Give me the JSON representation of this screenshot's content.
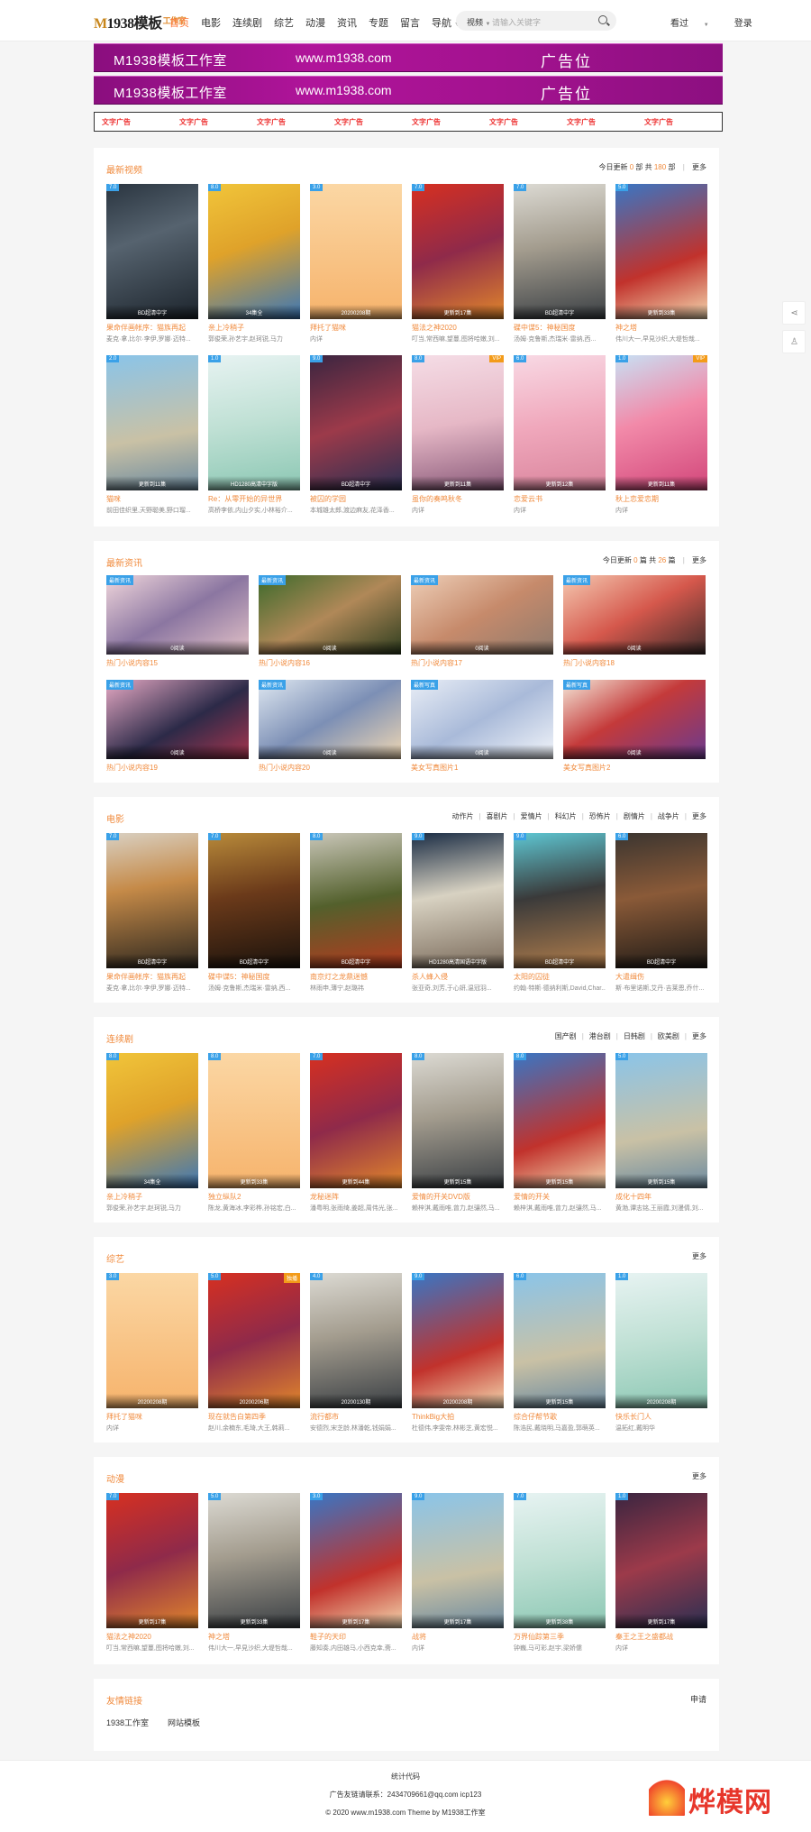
{
  "header": {
    "logo": {
      "m": "M",
      "num": "1938",
      "text": "模板",
      "sub": "工作室"
    },
    "nav": [
      "首页",
      "电影",
      "连续剧",
      "综艺",
      "动漫",
      "资讯",
      "专题",
      "留言",
      "导航"
    ],
    "search_select": "视频",
    "search_placeholder": "请输入关键字",
    "history": "看过",
    "login": "登录"
  },
  "banners": [
    {
      "t1": "M1938模板工作室",
      "t2": "www.m1938.com",
      "t3": "广告位"
    },
    {
      "t1": "M1938模板工作室",
      "t2": "www.m1938.com",
      "t3": "广告位"
    }
  ],
  "text_ads": [
    "文字广告",
    "文字广告",
    "文字广告",
    "文字广告",
    "文字广告",
    "文字广告",
    "文字广告",
    "文字广告"
  ],
  "latest_video": {
    "title": "最新视频",
    "stats": {
      "prefix": "今日更新",
      "today": "0",
      "unit1": "部 共",
      "total": "180",
      "unit2": "部"
    },
    "more": "更多",
    "items": [
      {
        "badge": "7.0",
        "cap": "BD超清中字",
        "title": "果命伴画帐序：猫族再起",
        "desc": "麦克·拿,比尔·李伊,罗娜·迈特..."
      },
      {
        "badge": "8.0",
        "cap": "34集全",
        "title": "亲上冷稍子",
        "desc": "郭俊荣,孙艺宇,赵珂锐,马力"
      },
      {
        "badge": "3.0",
        "cap": "20200208期",
        "title": "拜托了猫咪",
        "desc": "内详"
      },
      {
        "badge": "7.0",
        "cap": "更新到17集",
        "title": "猫法之神2020",
        "desc": "叮当,常西嘛,望蔓,图将哈嫩,刘..."
      },
      {
        "badge": "7.0",
        "cap": "BD超清中字",
        "title": "碟中谍5：神秘国度",
        "desc": "汤姆·克鲁斯,杰瑞米·雷纳,西..."
      },
      {
        "badge": "5.0",
        "cap": "更新到33集",
        "title": "神之塔",
        "desc": "伟川大一,早見沙织,大堤哲哉..."
      },
      {
        "badge": "2.0",
        "cap": "更新到11集",
        "title": "猫咪",
        "desc": "前田佳织里,天野聪美,野口瑠..."
      },
      {
        "badge": "1.0",
        "cap": "HD1280高清中字版",
        "title": "Re：从零开始的异世界",
        "desc": "高桥李依,内山夕实,小林裕介..."
      },
      {
        "badge": "9.0",
        "cap": "BD超清中字",
        "title": "被囚的学园",
        "desc": "本城雄太郎,渡边麻友,花泽香..."
      },
      {
        "badge": "8.0",
        "badge2": "VIP",
        "cap": "更新到11集",
        "title": "虽你的奏鸣秋冬",
        "desc": "内详"
      },
      {
        "badge": "6.0",
        "cap": "更新到12集",
        "title": "恋爱云书",
        "desc": "内详"
      },
      {
        "badge": "1.0",
        "badge2": "VIP",
        "cap": "更新到11集",
        "title": "秋上恋爱恋期",
        "desc": "内详"
      }
    ]
  },
  "latest_news": {
    "title": "最新资讯",
    "stats": {
      "prefix": "今日更新",
      "today": "0",
      "unit1": "篇 共",
      "total": "26",
      "unit2": "篇"
    },
    "more": "更多",
    "items": [
      {
        "badge": "最新资讯",
        "cap": "0阅读",
        "title": "热门小说内容15"
      },
      {
        "badge": "最新资讯",
        "cap": "0阅读",
        "title": "热门小说内容16"
      },
      {
        "badge": "最新资讯",
        "cap": "0阅读",
        "title": "热门小说内容17"
      },
      {
        "badge": "最新资讯",
        "cap": "0阅读",
        "title": "热门小说内容18"
      },
      {
        "badge": "最新资讯",
        "cap": "0阅读",
        "title": "热门小说内容19"
      },
      {
        "badge": "最新资讯",
        "cap": "0阅读",
        "title": "热门小说内容20"
      },
      {
        "badge": "最新写真",
        "cap": "0阅读",
        "title": "美女写真图片1"
      },
      {
        "badge": "最新写真",
        "cap": "0阅读",
        "title": "美女写真图片2"
      }
    ]
  },
  "movies": {
    "title": "电影",
    "tags": [
      "动作片",
      "喜剧片",
      "爱情片",
      "科幻片",
      "恐怖片",
      "剧情片",
      "战争片"
    ],
    "more": "更多",
    "items": [
      {
        "badge": "7.0",
        "cap": "BD超清中字",
        "title": "果命伴画帐序：猫族再起",
        "desc": "麦克·拿,比尔·李伊,罗娜·迈特..."
      },
      {
        "badge": "7.0",
        "cap": "BD超清中字",
        "title": "碟中谍5：神秘国度",
        "desc": "汤姆·克鲁斯,杰瑞米·雷纳,西..."
      },
      {
        "badge": "8.0",
        "cap": "BD超清中字",
        "title": "南京灯之龙鼎迷憾",
        "desc": "林雨申,薄宁,赵璐祎"
      },
      {
        "badge": "9.0",
        "cap": "HD1280高清国语中字版",
        "title": "杀人蜂入侵",
        "desc": "张亚奇,刘芳,于心妍,温冠羽..."
      },
      {
        "badge": "9.0",
        "cap": "BD超清中字",
        "title": "太阳的囚徒",
        "desc": "约翰·特斯·德纳利斯,David,Char..."
      },
      {
        "badge": "6.0",
        "cap": "BD超清中字",
        "title": "大遣缉伤",
        "desc": "斯·布里诺斯,艾丹·吉莱恩,乔什..."
      }
    ]
  },
  "series": {
    "title": "连续剧",
    "tags": [
      "国产剧",
      "港台剧",
      "日韩剧",
      "欧美剧"
    ],
    "more": "更多",
    "items": [
      {
        "badge": "8.0",
        "cap": "34集全",
        "title": "亲上冷稍子",
        "desc": "郭俊荣,孙艺宇,赵珂锐,马力"
      },
      {
        "badge": "8.0",
        "cap": "更新到33集",
        "title": "独立纵队2",
        "desc": "陈龙,黄海冰,李彩桦,孙铭宏,白..."
      },
      {
        "badge": "7.0",
        "cap": "更新到44集",
        "title": "龙秘迷阵",
        "desc": "潘粤明,张雨绮,姜超,周伟光,张..."
      },
      {
        "badge": "8.0",
        "cap": "更新到15集",
        "title": "爱情的开关DVD版",
        "desc": "赖梓淇,戴雨唯,曾力,赵骧然,马..."
      },
      {
        "badge": "8.0",
        "cap": "更新到15集",
        "title": "爱情的开关",
        "desc": "赖梓淇,戴雨唯,曾力,赵骧然,马..."
      },
      {
        "badge": "5.0",
        "cap": "更新到15集",
        "title": "成化十四年",
        "desc": "黄渤,谭志铭,王丽霞,刘漫倩,刘..."
      }
    ]
  },
  "variety": {
    "title": "综艺",
    "more": "更多",
    "items": [
      {
        "badge": "3.0",
        "cap": "20200208期",
        "title": "拜托了猫咪",
        "desc": "内详"
      },
      {
        "badge": "5.0",
        "badge2": "独播",
        "cap": "20200206期",
        "title": "现在就告白第四季",
        "desc": "赵川,余楠东,毛琦,大王,韩莉..."
      },
      {
        "badge": "4.0",
        "cap": "20200130期",
        "title": "流行都市",
        "desc": "安德烈,宋芝龄,林潘乾,钱娟娟..."
      },
      {
        "badge": "9.0",
        "cap": "20200208期",
        "title": "ThinkBig大拍",
        "desc": "杜德伟,李雯帝,林彬芝,黄宏悦..."
      },
      {
        "badge": "6.0",
        "cap": "更新到15集",
        "title": "综合仔帮节歌",
        "desc": "陈浩民,戴晓明,马嘉盈,郭萌英..."
      },
      {
        "badge": "1.0",
        "cap": "20200208期",
        "title": "快乐长门人",
        "desc": "温拓红,戴明华"
      }
    ]
  },
  "anime": {
    "title": "动漫",
    "more": "更多",
    "items": [
      {
        "badge": "7.0",
        "cap": "更新到17集",
        "title": "猫法之神2020",
        "desc": "叮当,常西嘛,望蔓,图将哈嫩,刘..."
      },
      {
        "badge": "5.0",
        "cap": "更新到33集",
        "title": "神之塔",
        "desc": "伟川大一,早見沙织,大堤哲哉..."
      },
      {
        "badge": "3.0",
        "cap": "更新到17集",
        "title": "鞋子的天印",
        "desc": "藤知奏,内田雄马,小西克幸,斋..."
      },
      {
        "badge": "9.0",
        "cap": "更新到17集",
        "title": "战将",
        "desc": "内详"
      },
      {
        "badge": "7.0",
        "cap": "更新到38集",
        "title": "万界仙踪第三季",
        "desc": "钟巍,马可彩,赵宇,梁娇儒"
      },
      {
        "badge": "1.0",
        "cap": "更新到17集",
        "title": "秦王之王之盛都战",
        "desc": "内详"
      }
    ]
  },
  "friend_links": {
    "title": "友情链接",
    "apply": "申请",
    "items": [
      "1938工作室",
      "网站模板"
    ]
  },
  "footer": {
    "line1": "统计代码",
    "line2": "广告友链请联系：2434709661@qq.com    icp123",
    "line3": "© 2020 www.m1938.com Theme by M1938工作室"
  },
  "watermark": "烨模网",
  "icons": [
    "search-icon",
    "share-icon",
    "shirt-icon",
    "chevron-down-icon"
  ]
}
